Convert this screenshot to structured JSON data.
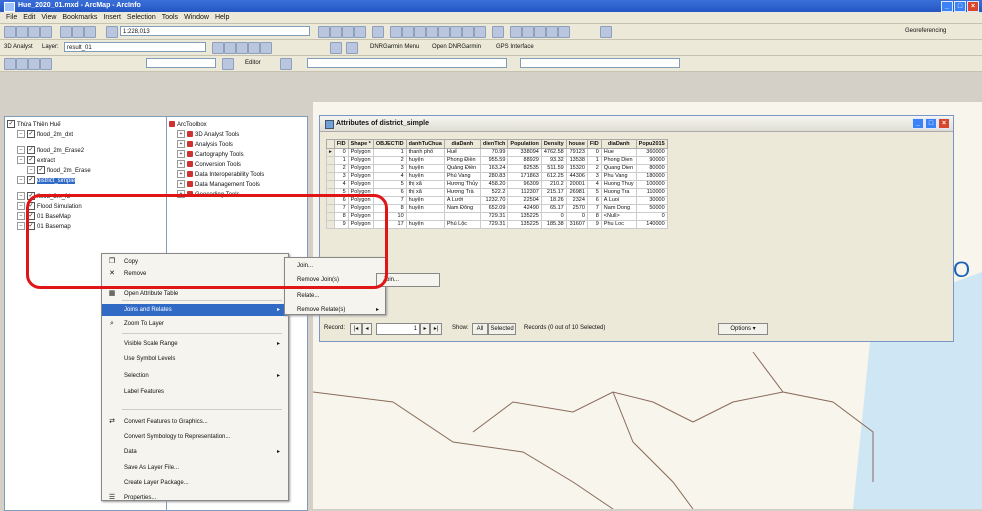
{
  "window": {
    "title": "Hue_2020_01.mxd - ArcMap - ArcInfo"
  },
  "menu": [
    "File",
    "Edit",
    "View",
    "Bookmarks",
    "Insert",
    "Selection",
    "Tools",
    "Window",
    "Help"
  ],
  "toolbar": {
    "scale_value": "1:228,013",
    "analyst_label": "3D Analyst",
    "layer_label": "Layer:",
    "layer_value": "result_01",
    "editor_label": "Editor",
    "dnr_menu": "DNRGarmin Menu",
    "open_dnr": "Open DNRGarmin",
    "gps_label": "GPS Interface",
    "georef_label": "Georeferencing"
  },
  "toc": {
    "items": [
      {
        "label": "Thừa Thiên Huế",
        "indent": 0
      },
      {
        "label": "flood_2m_dxt",
        "indent": 1
      },
      {
        "label": "flood_2m_Erase2",
        "indent": 1
      },
      {
        "label": "extract",
        "indent": 1
      },
      {
        "label": "flood_2m_Erase",
        "indent": 2
      },
      {
        "label": "district_simple",
        "indent": 1
      },
      {
        "label": "flood_2m_fd",
        "indent": 1
      },
      {
        "label": "Flood Simulation",
        "indent": 1
      },
      {
        "label": "01 BaseMap",
        "indent": 1
      },
      {
        "label": "01 Basemap",
        "indent": 1
      }
    ]
  },
  "arctoolbox": {
    "title": "ArcToolbox",
    "items": [
      "3D Analyst Tools",
      "Analysis Tools",
      "Cartography Tools",
      "Conversion Tools",
      "Data Interoperability Tools",
      "Data Management Tools",
      "Geocoding Tools"
    ]
  },
  "context_menu": {
    "items": [
      {
        "label": "Copy",
        "icon": "copy-icon",
        "arrow": false
      },
      {
        "label": "Remove",
        "icon": "x-icon",
        "arrow": false
      },
      {
        "label": "Open Attribute Table",
        "icon": "table-icon",
        "arrow": false
      },
      {
        "label": "Joins and Relates",
        "icon": "",
        "arrow": true,
        "highlight": true
      },
      {
        "label": "Zoom To Layer",
        "icon": "zoom-icon",
        "arrow": false
      },
      {
        "label": "Visible Scale Range",
        "icon": "",
        "arrow": true
      },
      {
        "label": "Use Symbol Levels",
        "icon": "",
        "arrow": false
      },
      {
        "label": "Selection",
        "icon": "",
        "arrow": true
      },
      {
        "label": "Label Features",
        "icon": "",
        "arrow": false
      },
      {
        "label": "Convert Features to Graphics...",
        "icon": "convert-icon",
        "arrow": false
      },
      {
        "label": "Convert Symbology to Representation...",
        "icon": "",
        "arrow": false
      },
      {
        "label": "Data",
        "icon": "",
        "arrow": true
      },
      {
        "label": "Save As Layer File...",
        "icon": "",
        "arrow": false
      },
      {
        "label": "Create Layer Package...",
        "icon": "",
        "arrow": false
      },
      {
        "label": "Properties...",
        "icon": "properties-icon",
        "arrow": false
      }
    ],
    "submenu": [
      "Join...",
      "Remove Join(s)",
      "Relate...",
      "Remove Relate(s)"
    ],
    "submenu2": [
      "Join..."
    ]
  },
  "attributes": {
    "title": "Attributes of district_simple",
    "columns": [
      "FID",
      "Shape *",
      "OBJECTID",
      "danhTuChua",
      "diaDanh",
      "dienTich",
      "Population",
      "Density",
      "house",
      "FID",
      "diaDanh",
      "Popu2015"
    ],
    "rows": [
      [
        "0",
        "Polygon",
        "1",
        "thanh phố",
        "Huế",
        "70.99",
        "338094",
        "4762.58",
        "79123",
        "0",
        "Hue",
        "360000"
      ],
      [
        "1",
        "Polygon",
        "2",
        "huyện",
        "Phong Điền",
        "955.59",
        "88929",
        "93.32",
        "13538",
        "1",
        "Phong Dien",
        "90000"
      ],
      [
        "2",
        "Polygon",
        "3",
        "huyện",
        "Quảng Điền",
        "163.24",
        "82535",
        "511.59",
        "15320",
        "2",
        "Quang Dien",
        "80000"
      ],
      [
        "3",
        "Polygon",
        "4",
        "huyện",
        "Phú Vang",
        "280.83",
        "171863",
        "612.25",
        "44306",
        "3",
        "Phu Vang",
        "180000"
      ],
      [
        "4",
        "Polygon",
        "5",
        "thị xã",
        "Hương Thủy",
        "458.20",
        "96309",
        "210.2",
        "20001",
        "4",
        "Huong Thuy",
        "100000"
      ],
      [
        "5",
        "Polygon",
        "6",
        "thị xã",
        "Hương Trà",
        "522.2",
        "112307",
        "215.17",
        "26981",
        "5",
        "Huong Tra",
        "110000"
      ],
      [
        "6",
        "Polygon",
        "7",
        "huyện",
        "A Lưới",
        "1232.70",
        "22504",
        "18.26",
        "2324",
        "6",
        "A Luoi",
        "30000"
      ],
      [
        "7",
        "Polygon",
        "8",
        "huyện",
        "Nam Đông",
        "652.09",
        "42490",
        "65.17",
        "2570",
        "7",
        "Nam Dong",
        "50000"
      ],
      [
        "8",
        "Polygon",
        "10",
        "",
        "",
        "729.31",
        "135225",
        "0",
        "0",
        "8",
        "<Null>",
        "0"
      ],
      [
        "9",
        "Polygon",
        "17",
        "huyện",
        "Phú Lộc",
        "729.31",
        "135225",
        "185.38",
        "31607",
        "9",
        "Phu Loc",
        "140000"
      ]
    ],
    "record_label": "Record:",
    "record_value": "1",
    "show_label": "Show:",
    "all_label": "All",
    "selected_label": "Selected",
    "records_text": "Records (0 out of 10 Selected)",
    "options_label": "Options"
  },
  "colors": {
    "highlight": "#e01616",
    "selection": "#316ac5"
  }
}
